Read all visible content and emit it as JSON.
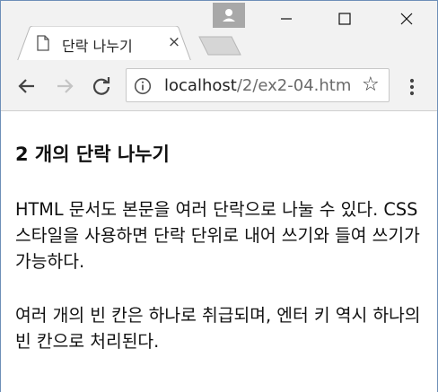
{
  "tab": {
    "title": "단락 나누기",
    "close_label": "×"
  },
  "address_bar": {
    "host": "localhost",
    "path": "/2/ex2-04.htm"
  },
  "page": {
    "heading": "2 개의 단락 나누기",
    "paragraphs": [
      "HTML 문서도 본문을 여러 단락으로 나눌 수 있다. CSS 스타일을 사용하면 단락 단위로 내어 쓰기와 들여 쓰기가 가능하다.",
      "여러 개의 빈 칸은 하나로 취급되며, 엔터 키 역시 하나의 빈 칸으로 처리된다."
    ]
  },
  "icons": {
    "profile": "person-icon",
    "minimize": "minimize-icon",
    "maximize": "maximize-icon",
    "close": "close-icon",
    "back": "back-arrow-icon",
    "forward": "forward-arrow-icon",
    "reload": "reload-icon",
    "info": "info-icon",
    "bookmark": "star-icon",
    "menu": "kebab-menu-icon"
  }
}
